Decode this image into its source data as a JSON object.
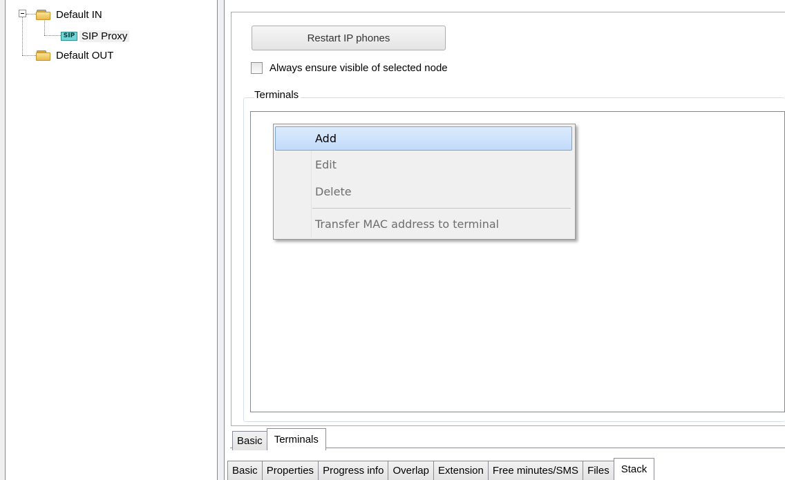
{
  "tree": {
    "nodes": [
      {
        "label": "Default IN",
        "icon": "folder-icon"
      },
      {
        "label": "SIP Proxy",
        "icon": "sip-icon",
        "icon_text": "SIP"
      },
      {
        "label": "Default OUT",
        "icon": "folder-icon"
      }
    ]
  },
  "panel": {
    "restart_button": "Restart IP phones",
    "always_visible_label": "Always ensure visible of selected node",
    "always_visible_checked": false,
    "terminals_group": "Terminals"
  },
  "context_menu": {
    "items": [
      {
        "label": "Add",
        "state": "highlighted"
      },
      {
        "label": "Edit",
        "state": "disabled"
      },
      {
        "label": "Delete",
        "state": "disabled"
      },
      {
        "label": "Transfer MAC address to terminal",
        "state": "disabled"
      }
    ]
  },
  "inner_tabs": {
    "tabs": [
      "Basic",
      "Terminals"
    ],
    "active": "Terminals"
  },
  "outer_tabs": {
    "tabs": [
      "Basic",
      "Properties",
      "Progress info",
      "Overlap",
      "Extension",
      "Free minutes/SMS",
      "Files",
      "Stack"
    ],
    "active": "Stack"
  },
  "colors": {
    "menu_highlight": "#c1dbfc",
    "menu_highlight_border": "#7da2ce",
    "sip_badge": "#6fd5d6"
  }
}
